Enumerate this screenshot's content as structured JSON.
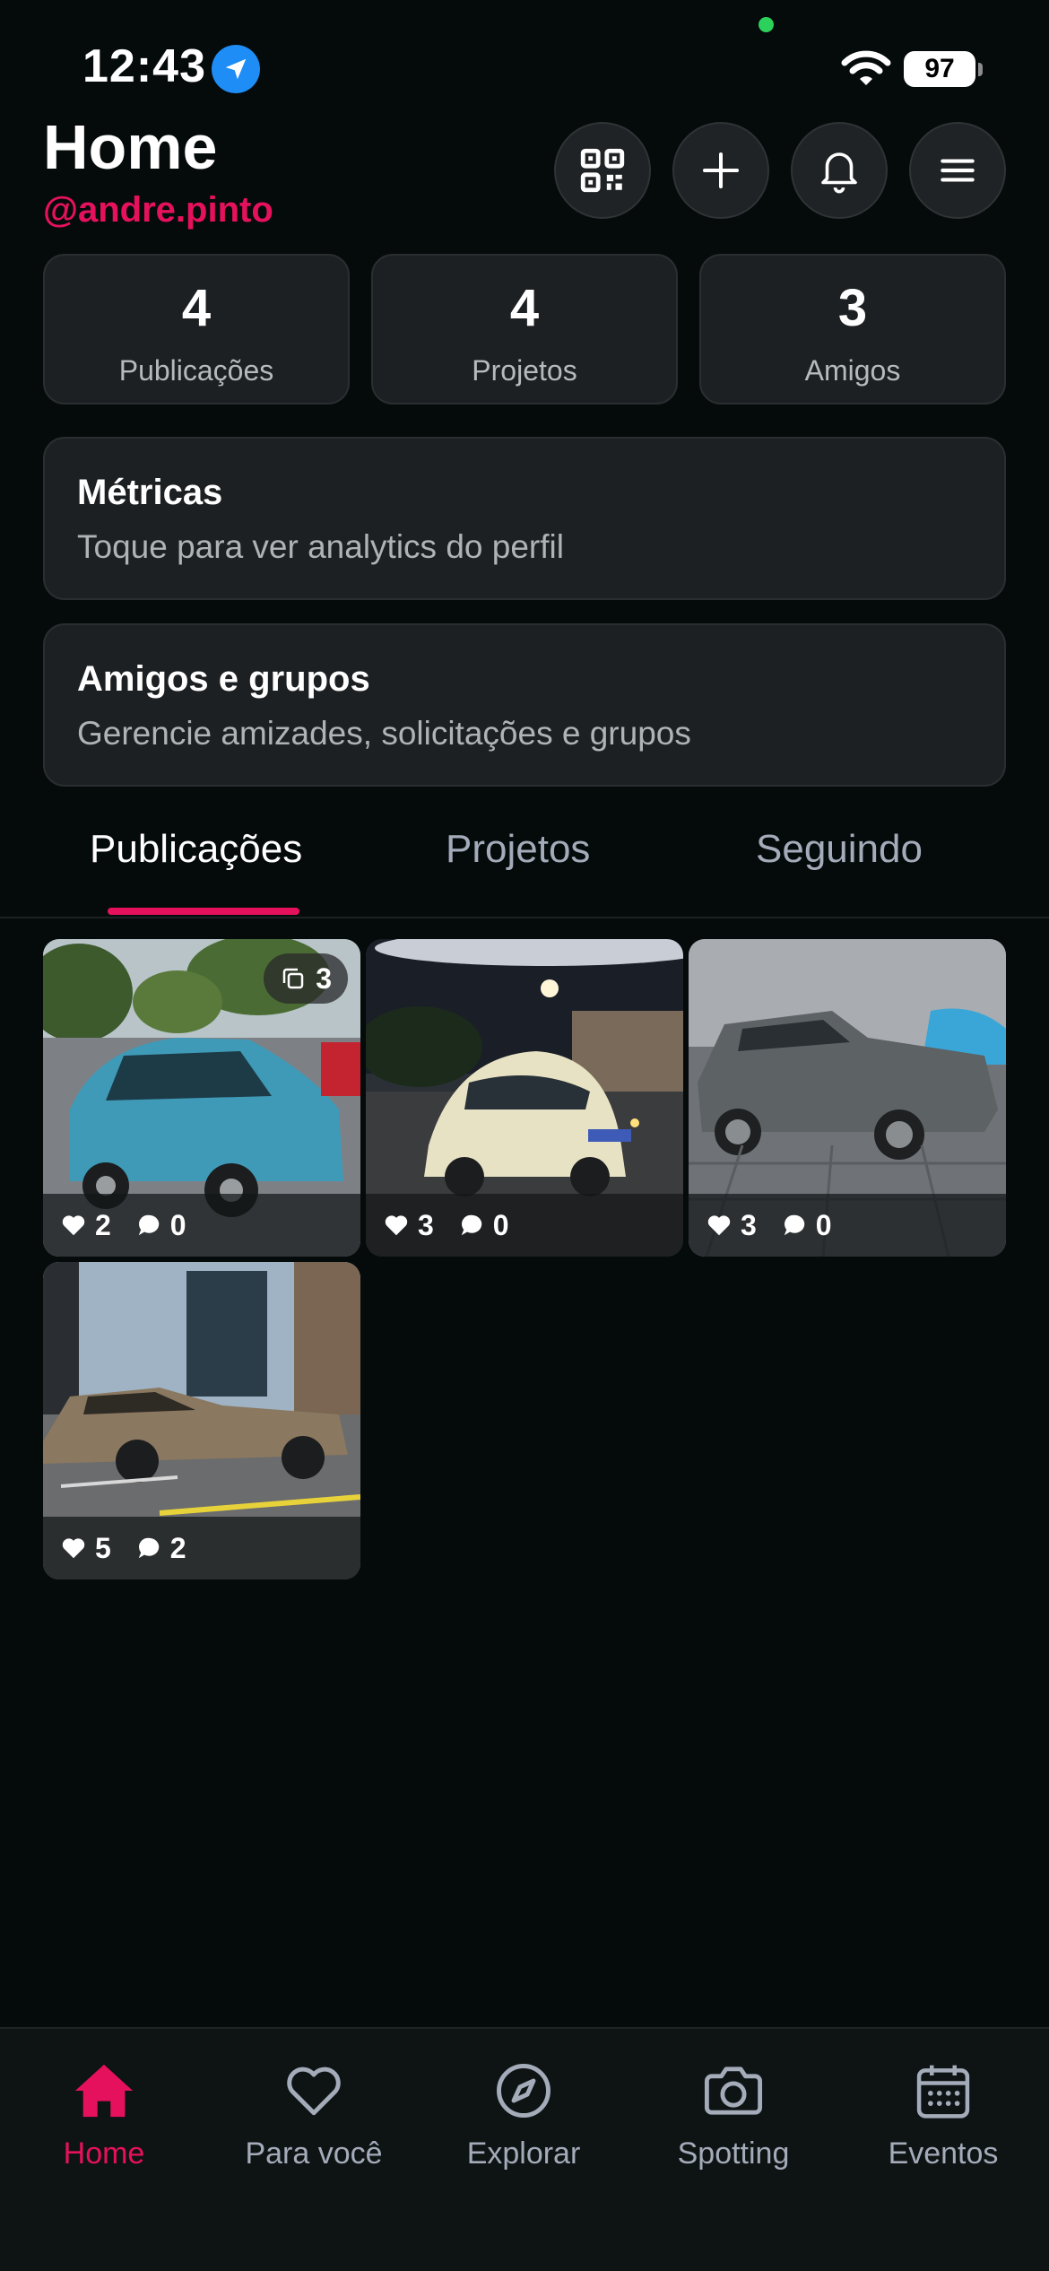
{
  "status_bar": {
    "time": "12:43",
    "battery": "97"
  },
  "header": {
    "title": "Home",
    "handle": "@andre.pinto"
  },
  "header_actions": [
    "qr-code-icon",
    "plus-icon",
    "bell-icon",
    "menu-icon"
  ],
  "stats": [
    {
      "value": "4",
      "label": "Publicações"
    },
    {
      "value": "4",
      "label": "Projetos"
    },
    {
      "value": "3",
      "label": "Amigos"
    }
  ],
  "cards": [
    {
      "title": "Métricas",
      "subtitle": "Toque para ver analytics do perfil"
    },
    {
      "title": "Amigos e grupos",
      "subtitle": "Gerencie amizades, solicitações e grupos"
    }
  ],
  "tabs": [
    {
      "label": "Publicações",
      "active": true
    },
    {
      "label": "Projetos",
      "active": false
    },
    {
      "label": "Seguindo",
      "active": false
    }
  ],
  "posts": [
    {
      "likes": "2",
      "comments": "0",
      "multi_count": "3",
      "car": "blue coupe"
    },
    {
      "likes": "3",
      "comments": "0",
      "car": "cream beetle"
    },
    {
      "likes": "3",
      "comments": "0",
      "car": "grey pickup"
    },
    {
      "likes": "5",
      "comments": "2",
      "car": "bronze hatchback"
    }
  ],
  "tab_bar": [
    {
      "label": "Home",
      "icon": "home-icon",
      "active": true
    },
    {
      "label": "Para você",
      "icon": "heart-icon",
      "active": false
    },
    {
      "label": "Explorar",
      "icon": "compass-icon",
      "active": false
    },
    {
      "label": "Spotting",
      "icon": "camera-icon",
      "active": false
    },
    {
      "label": "Eventos",
      "icon": "calendar-icon",
      "active": false
    }
  ],
  "colors": {
    "accent": "#e6115d",
    "background": "#050a0b",
    "card": "#1d2022",
    "muted": "#a4abb9"
  }
}
